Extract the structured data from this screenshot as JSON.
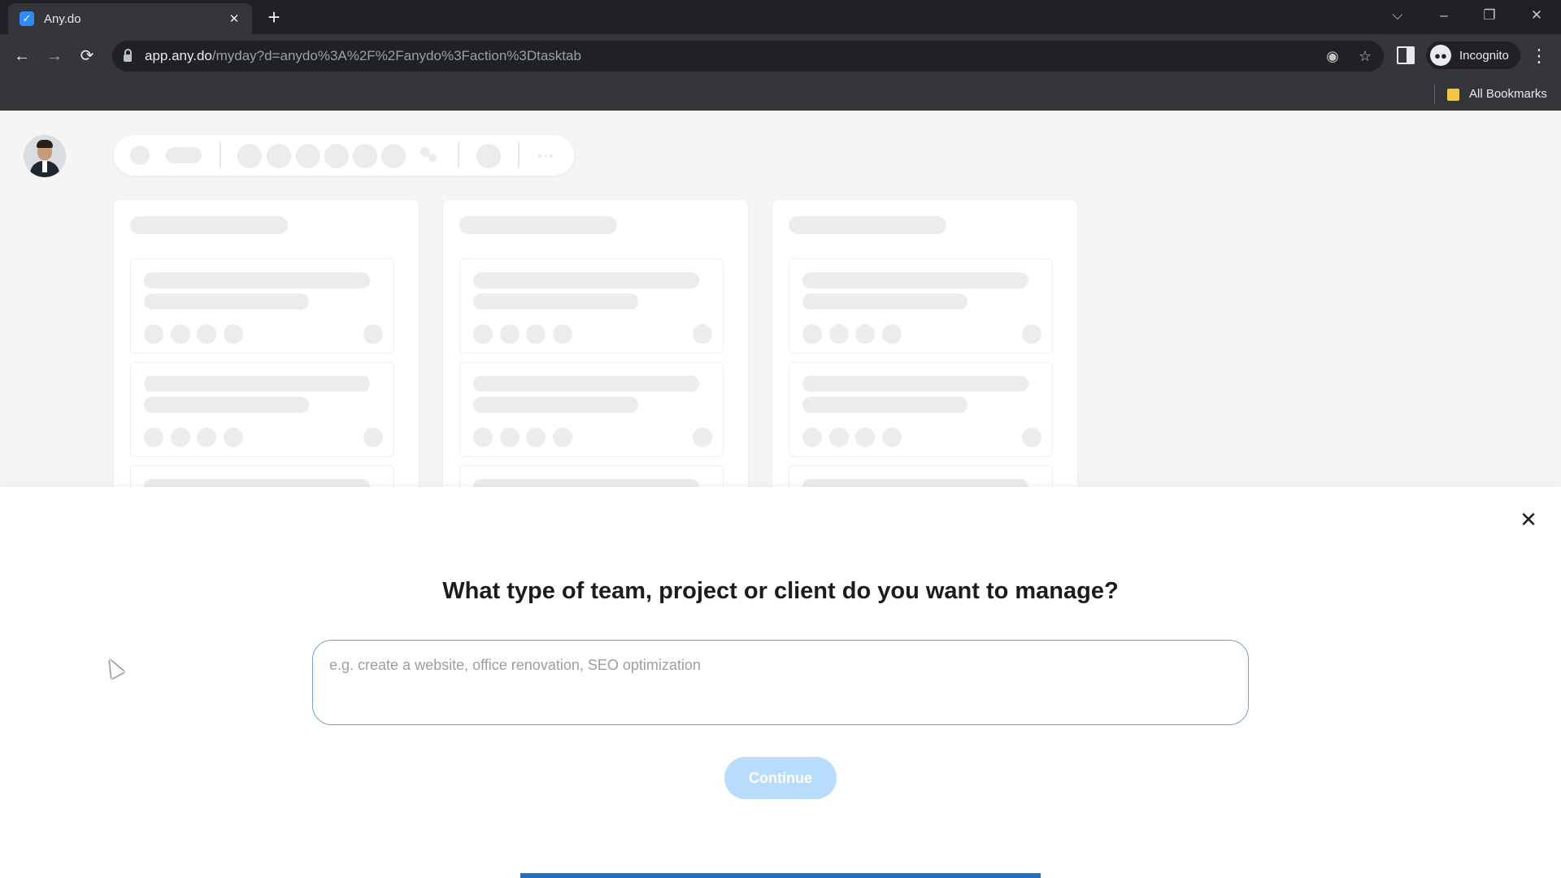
{
  "browser": {
    "tab_title": "Any.do",
    "tab_favicon_glyph": "✓",
    "new_tab_glyph": "+",
    "close_tab_glyph": "✕",
    "url_host": "app.any.do",
    "url_path": "/myday?d=anydo%3A%2F%2Fanydo%3Faction%3Dtasktab",
    "profile_label": "Incognito",
    "bookmarks_label": "All Bookmarks",
    "icons": {
      "back": "←",
      "forward": "→",
      "reload": "⟳",
      "tracking": "◉",
      "star": "☆",
      "tab_search": "⌵",
      "minimize": "–",
      "maximize": "❐",
      "close": "✕",
      "menu": "⋮",
      "more_dots": "···"
    }
  },
  "modal": {
    "title": "What type of team, project or client do you want to manage?",
    "input_placeholder": "e.g. create a website, office renovation, SEO optimization",
    "input_value": "",
    "continue_label": "Continue",
    "close_glyph": "✕",
    "progress": 1.0
  },
  "colors": {
    "accent": "#2f6db8",
    "continue_disabled": "#b8dcfb",
    "input_border": "#6fa1d6",
    "favicon": "#2f8bfb"
  }
}
